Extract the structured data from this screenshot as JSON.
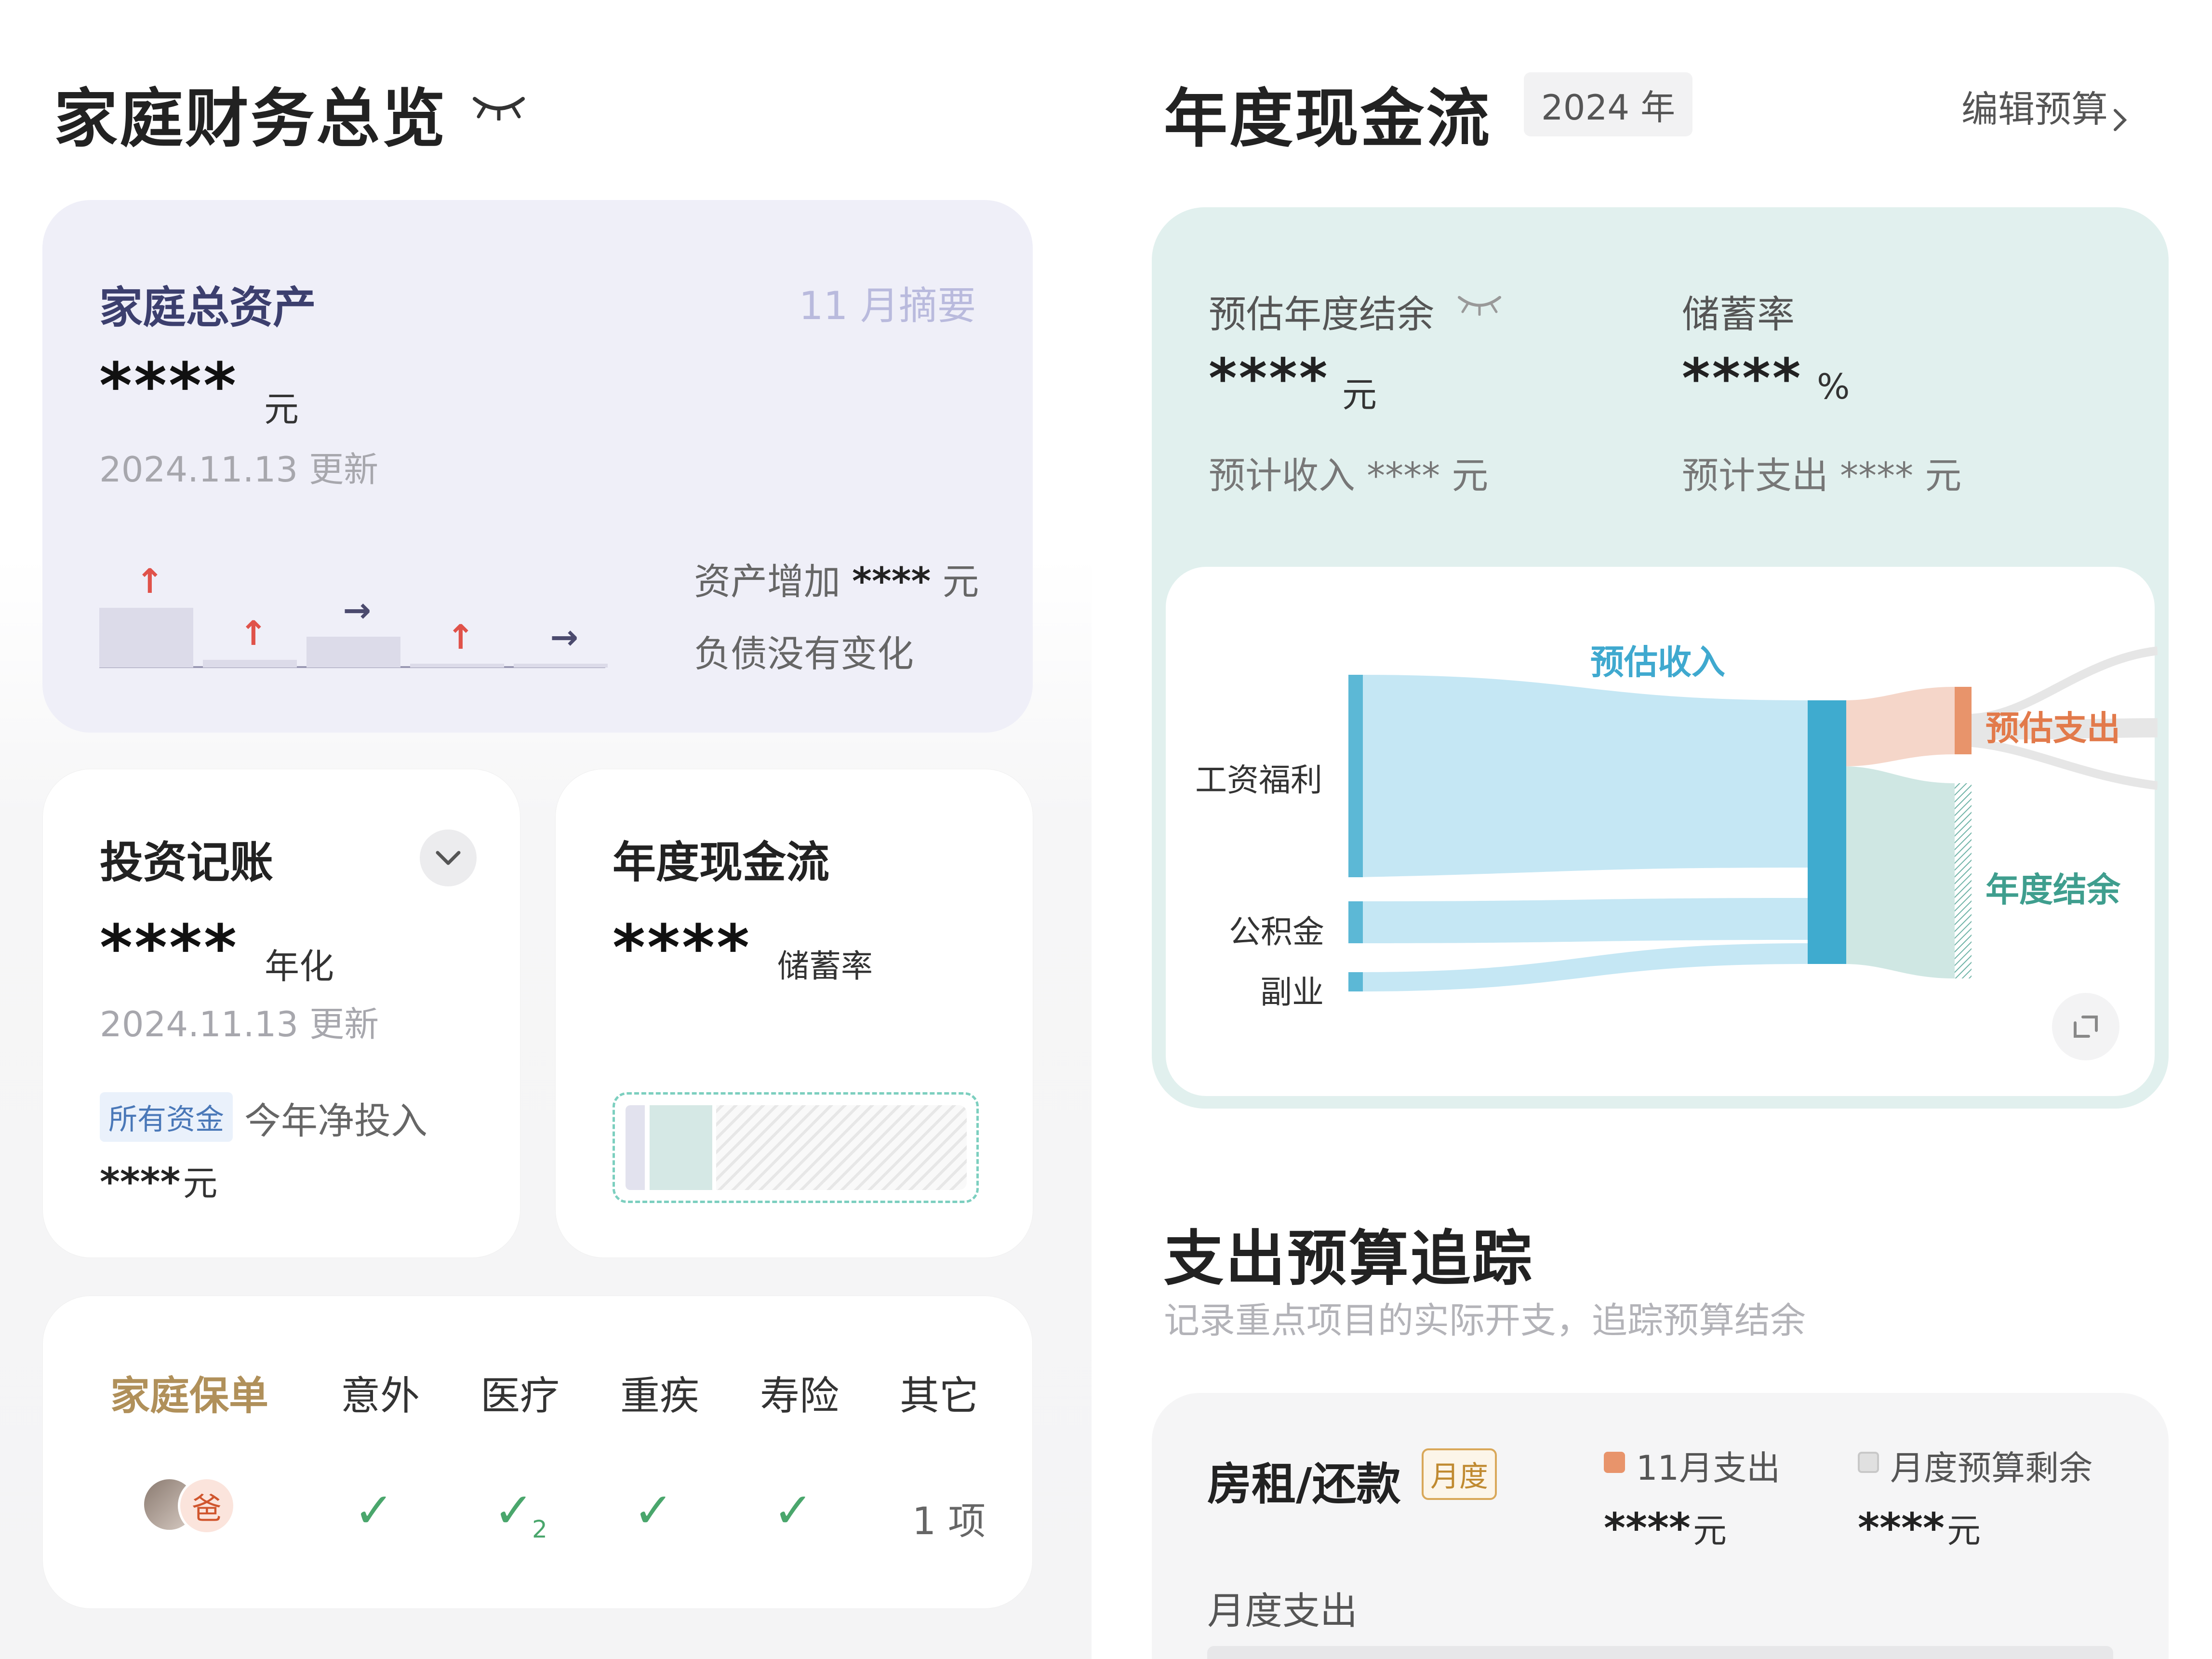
{
  "left": {
    "title": "家庭财务总览",
    "eye_icon": "eye-closed-icon",
    "assets": {
      "title": "家庭总资产",
      "summary_link": "11 月摘要",
      "value": "****",
      "unit": "元",
      "updated": "2024.11.13 更新",
      "increase_label": "资产增加",
      "increase_value": "****",
      "increase_unit": "元",
      "liability_text": "负债没有变化",
      "mini_bars": [
        {
          "level": 0.62,
          "trend": "up"
        },
        {
          "level": 0.08,
          "trend": "up"
        },
        {
          "level": 0.32,
          "trend": "right"
        },
        {
          "level": 0.02,
          "trend": "up"
        },
        {
          "level": 0.01,
          "trend": "right"
        }
      ]
    },
    "invest": {
      "title": "投资记账",
      "value": "****",
      "unit": "年化",
      "updated": "2024.11.13 更新",
      "tag": "所有资金",
      "net_label": "今年净投入",
      "net_value": "****",
      "net_unit": "元"
    },
    "cashflow_mini": {
      "title": "年度现金流",
      "value": "****",
      "unit": "储蓄率"
    },
    "insurance": {
      "title": "家庭保单",
      "columns": [
        "意外",
        "医疗",
        "重疾",
        "寿险",
        "其它"
      ],
      "member_badge": "爸",
      "medical_count": "2",
      "other_count": "1 项"
    }
  },
  "right": {
    "title": "年度现金流",
    "year": "2024 年",
    "edit_budget": "编辑预算",
    "balance_label": "预估年度结余",
    "balance_value": "****",
    "balance_unit": "元",
    "savings_label": "储蓄率",
    "savings_value": "****",
    "savings_unit": "%",
    "income_text": "预计收入 **** 元",
    "expense_text": "预计支出 **** 元",
    "sankey": {
      "income_node": "预估收入",
      "sources": [
        "工资福利",
        "公积金",
        "副业"
      ],
      "expense_node": "预估支出",
      "balance_node": "年度结余"
    },
    "budget": {
      "title": "支出预算追踪",
      "subtitle": "记录重点项目的实际开支，追踪预算结余",
      "item_title": "房租/还款",
      "item_tag": "月度",
      "spent_label": "11月支出",
      "spent_value": "****",
      "spent_unit": "元",
      "remain_label": "月度预算剩余",
      "remain_value": "****",
      "remain_unit": "元",
      "monthly_label": "月度支出"
    }
  },
  "colors": {
    "income_blue": "#5cb8d6",
    "expense_orange": "#e8946b",
    "balance_teal": "#3f9e8e",
    "lilac_card": "#efeff8",
    "teal_card": "#e1f0ee"
  }
}
